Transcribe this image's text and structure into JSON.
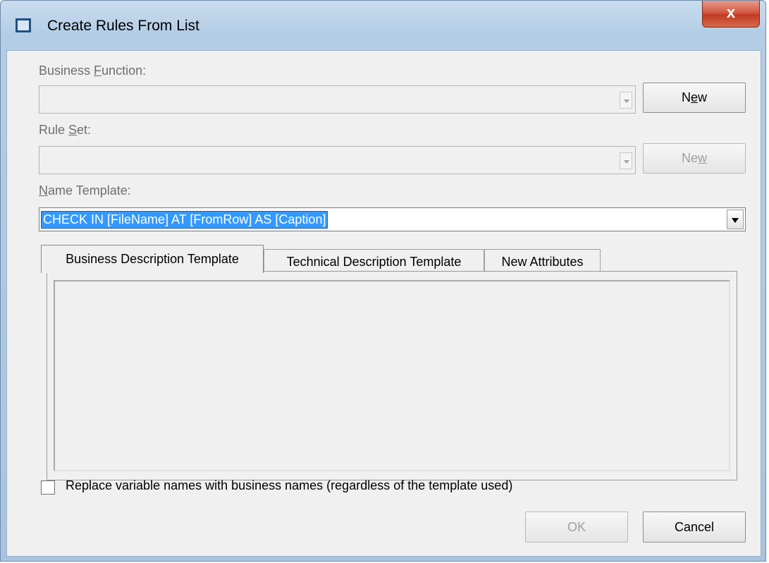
{
  "window": {
    "title": "Create Rules From List",
    "close_label": "x"
  },
  "business_function": {
    "label_pre": "Business ",
    "label_accel": "F",
    "label_post": "unction:",
    "value": "",
    "new_pre": "N",
    "new_accel": "e",
    "new_post": "w"
  },
  "rule_set": {
    "label_pre": "Rule ",
    "label_accel": "S",
    "label_post": "et:",
    "value": "",
    "new_pre": "Ne",
    "new_accel": "w",
    "new_post": ""
  },
  "name_template": {
    "label_accel": "N",
    "label_post": "ame Template:",
    "value": "CHECK IN [FileName] AT [FromRow] AS [Caption]"
  },
  "tabs": [
    {
      "label": "Business Description Template",
      "active": true
    },
    {
      "label": "Technical Description Template",
      "active": false
    },
    {
      "label": "New Attributes",
      "active": false
    }
  ],
  "replace_checkbox": {
    "label": "Replace variable names with business names (regardless of the template used)",
    "checked": false
  },
  "buttons": {
    "ok": "OK",
    "cancel": "Cancel"
  }
}
